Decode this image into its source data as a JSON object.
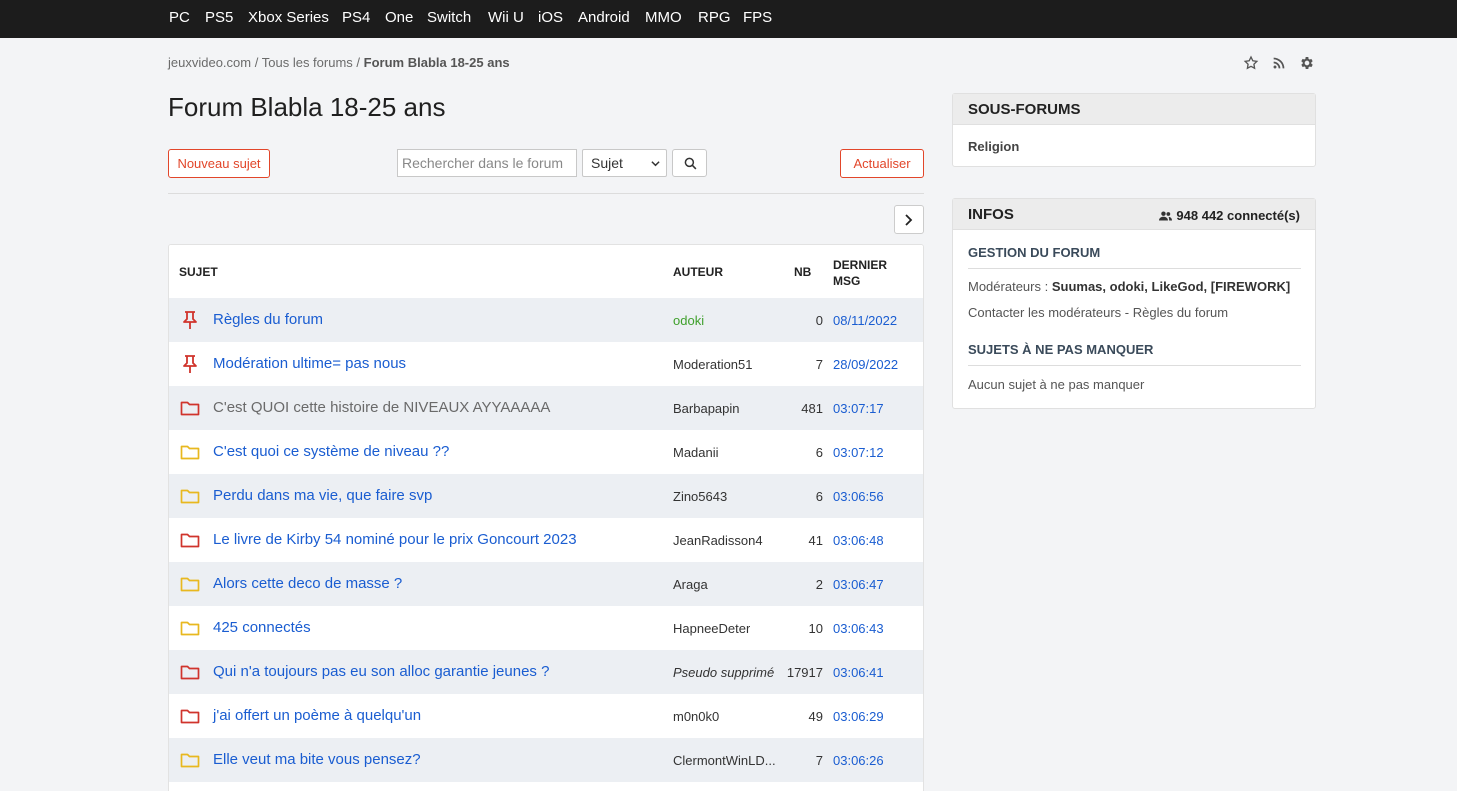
{
  "nav": [
    "PC",
    "PS5",
    "Xbox Series",
    "PS4",
    "One",
    "Switch",
    "Wii U",
    "iOS",
    "Android",
    "MMO",
    "RPG",
    "FPS"
  ],
  "breadcrumb": {
    "home": "jeuxvideo.com",
    "sep": "/",
    "forums": "Tous les forums",
    "current": "Forum Blabla 18-25 ans"
  },
  "page_title": "Forum Blabla 18-25 ans",
  "toolbar": {
    "new_topic": "Nouveau sujet",
    "search_placeholder": "Rechercher dans le forum",
    "search_scope": "Sujet",
    "refresh": "Actualiser"
  },
  "table": {
    "headers": {
      "subject": "SUJET",
      "author": "AUTEUR",
      "count": "NB",
      "last": "DERNIER MSG"
    },
    "rows": [
      {
        "icon": "pin-icon",
        "subject": "Règles du forum",
        "author": "odoki",
        "nb": "0",
        "date": "08/11/2022"
      },
      {
        "icon": "pin-icon",
        "subject": "Modération ultime= pas nous",
        "author": "Moderation51",
        "nb": "7",
        "date": "28/09/2022"
      },
      {
        "icon": "folder-red-icon",
        "subject": "C'est QUOI cette histoire de NIVEAUX AYYAAAAA",
        "author": "Barbapapin",
        "nb": "481",
        "date": "03:07:17"
      },
      {
        "icon": "folder-yellow-icon",
        "subject": "C'est quoi ce système de niveau ??",
        "author": "Madanii",
        "nb": "6",
        "date": "03:07:12"
      },
      {
        "icon": "folder-yellow-icon",
        "subject": "Perdu dans ma vie, que faire svp",
        "author": "Zino5643",
        "nb": "6",
        "date": "03:06:56"
      },
      {
        "icon": "folder-red-icon",
        "subject": "Le livre de Kirby 54 nominé pour le prix Goncourt 2023",
        "author": "JeanRadisson4",
        "nb": "41",
        "date": "03:06:48"
      },
      {
        "icon": "folder-yellow-icon",
        "subject": "Alors cette deco de masse ?",
        "author": "Araga",
        "nb": "2",
        "date": "03:06:47"
      },
      {
        "icon": "folder-yellow-icon",
        "subject": "425 connectés",
        "author": "HapneeDeter",
        "nb": "10",
        "date": "03:06:43"
      },
      {
        "icon": "folder-red-icon",
        "subject": "Qui n'a toujours pas eu son alloc garantie jeunes ?",
        "author": "Pseudo supprimé",
        "nb": "17917",
        "date": "03:06:41"
      },
      {
        "icon": "folder-red-icon",
        "subject": "j'ai offert un poème à quelqu'un",
        "author": "m0n0k0",
        "nb": "49",
        "date": "03:06:29"
      },
      {
        "icon": "folder-yellow-icon",
        "subject": "Elle veut ma bite vous pensez?",
        "author": "ClermontWinLD...",
        "nb": "7",
        "date": "03:06:26"
      }
    ]
  },
  "sidebar": {
    "subforums": {
      "title": "SOUS-FORUMS",
      "items": [
        "Religion"
      ]
    },
    "info": {
      "title": "INFOS",
      "online": "948 442 connecté(s)",
      "manage_title": "GESTION DU FORUM",
      "moderators_label": "Modérateurs :",
      "moderators": "Suumas, odoki, LikeGod, [FIREWORK]",
      "contact": "Contacter les modérateurs - Règles du forum",
      "must_read_title": "SUJETS À NE PAS MANQUER",
      "must_read_empty": "Aucun sujet à ne pas manquer"
    }
  },
  "colors": {
    "accent": "#e2462a",
    "link": "#1a5dd1",
    "moderator": "#3fa02c",
    "folder_hot": "#d0342c",
    "folder_normal": "#e8b81f"
  }
}
